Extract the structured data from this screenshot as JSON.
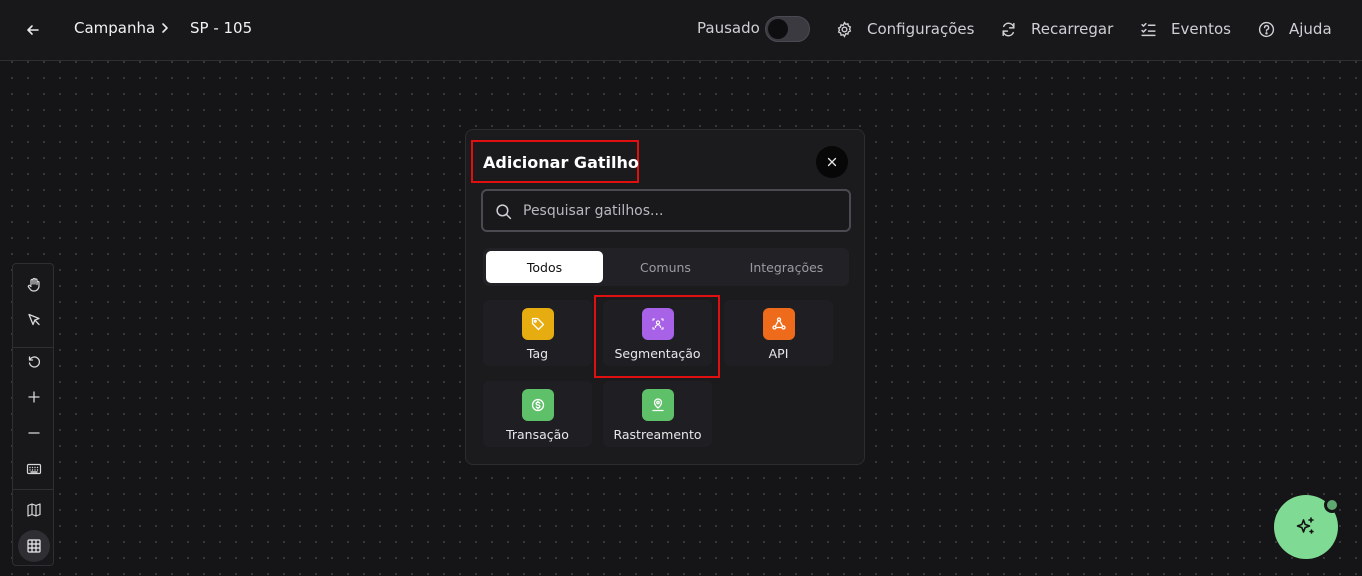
{
  "header": {
    "breadcrumb": [
      "Campanha",
      "SP - 105"
    ],
    "status_label": "Pausado",
    "actions": {
      "settings": "Configurações",
      "reload": "Recarregar",
      "events": "Eventos",
      "help": "Ajuda"
    }
  },
  "toolbar": {
    "tools": [
      "hand-icon",
      "pointer-icon",
      "undo-icon",
      "plus-icon",
      "minus-icon",
      "keyboard-icon",
      "map-icon",
      "grid-icon"
    ]
  },
  "modal": {
    "title": "Adicionar Gatilho",
    "search_placeholder": "Pesquisar gatilhos...",
    "tabs": [
      "Todos",
      "Comuns",
      "Integrações"
    ],
    "triggers": [
      {
        "label": "Tag",
        "color": "#e6ac10"
      },
      {
        "label": "Segmentação",
        "color": "#a862e8"
      },
      {
        "label": "API",
        "color": "#ee6b1c"
      },
      {
        "label": "Transação",
        "color": "#5fc06a"
      },
      {
        "label": "Rastreamento",
        "color": "#5fc06a"
      }
    ]
  },
  "colors": {
    "highlight": "#e01010",
    "fab": "#7fdb93"
  }
}
